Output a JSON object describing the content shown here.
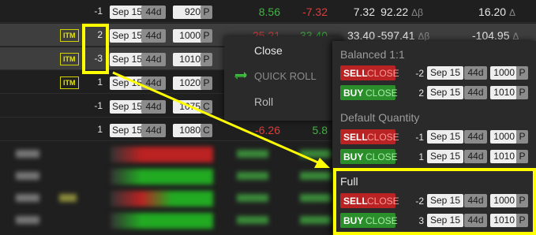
{
  "positions": [
    {
      "qty": "-1",
      "date": "Sep 15",
      "dte": "44d",
      "strike": "920",
      "type": "P",
      "c1": "8.56",
      "c2": "-7.32",
      "c3": "7.32",
      "c4": "92.22",
      "c5": "16.20",
      "sym4": "Δβ",
      "sym5": "Δ"
    },
    {
      "itm": "ITM",
      "qty": "2",
      "date": "Sep 15",
      "dte": "44d",
      "strike": "1000",
      "type": "P",
      "c1": "-25.21",
      "c2": "33.40",
      "c3": "33.40",
      "c4": "-597.41",
      "c5": "-104.95",
      "sym4": "Δβ",
      "sym5": "Δ"
    },
    {
      "itm": "ITM",
      "qty": "-3",
      "date": "Sep 15",
      "dte": "44d",
      "strike": "1010",
      "type": "P"
    },
    {
      "itm": "ITM",
      "qty": "1",
      "date": "Sep 15",
      "dte": "44d",
      "strike": "1020",
      "type": "P"
    },
    {
      "qty": "-1",
      "date": "Sep 15",
      "dte": "44d",
      "strike": "1075",
      "type": "C"
    },
    {
      "qty": "1",
      "date": "Sep 15",
      "dte": "44d",
      "strike": "1080",
      "type": "C",
      "c1": "-6.26",
      "c2": "5.8"
    }
  ],
  "context_menu": {
    "close": "Close",
    "quick_roll": "QUICK ROLL",
    "roll": "Roll"
  },
  "submenu": {
    "sections": [
      {
        "title": "Balanced 1:1",
        "rows": [
          {
            "action": "SELL",
            "close": "CLOSE",
            "qty": "-2",
            "date": "Sep 15",
            "dte": "44d",
            "strike": "1000",
            "type": "P"
          },
          {
            "action": "BUY",
            "close": "CLOSE",
            "qty": "2",
            "date": "Sep 15",
            "dte": "44d",
            "strike": "1010",
            "type": "P"
          }
        ]
      },
      {
        "title": "Default Quantity",
        "rows": [
          {
            "action": "SELL",
            "close": "CLOSE",
            "qty": "-1",
            "date": "Sep 15",
            "dte": "44d",
            "strike": "1000",
            "type": "P"
          },
          {
            "action": "BUY",
            "close": "CLOSE",
            "qty": "1",
            "date": "Sep 15",
            "dte": "44d",
            "strike": "1010",
            "type": "P"
          }
        ]
      },
      {
        "title": "Full",
        "rows": [
          {
            "action": "SELL",
            "close": "CLOSE",
            "qty": "-2",
            "date": "Sep 15",
            "dte": "44d",
            "strike": "1000",
            "type": "P"
          },
          {
            "action": "BUY",
            "close": "CLOSE",
            "qty": "3",
            "date": "Sep 15",
            "dte": "44d",
            "strike": "1010",
            "type": "P"
          }
        ]
      }
    ]
  },
  "colors": {
    "highlight": "#ffff00",
    "sell": "#b92323",
    "buy": "#2a8f2a",
    "gain": "#3fb63f",
    "loss": "#e23b3b"
  }
}
